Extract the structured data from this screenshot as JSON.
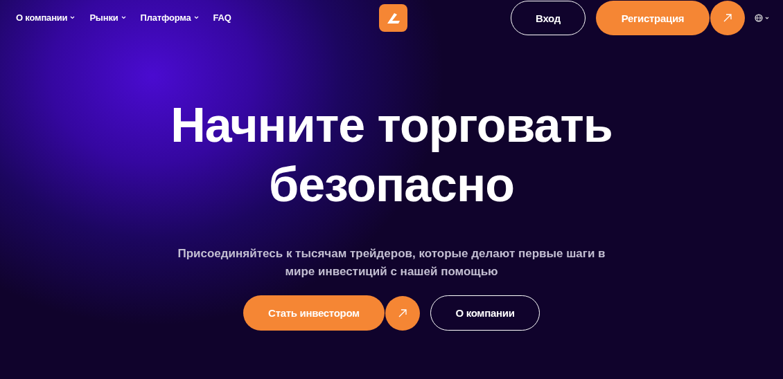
{
  "nav": {
    "items": [
      {
        "label": "О компании",
        "kind": "dropdown"
      },
      {
        "label": "Рынки",
        "kind": "dropdown"
      },
      {
        "label": "Платформа",
        "kind": "dropdown"
      },
      {
        "label": "FAQ",
        "kind": "link"
      }
    ],
    "login": "Вход",
    "register": "Регистрация"
  },
  "hero": {
    "title_lines": [
      "Начните торговать",
      "безопасно"
    ],
    "subtitle": "Присоединяйтесь к тысячам трейдеров, которые делают первые шаги в мире инвестиций с нашей помощью",
    "primary_button": "Стать инвестором",
    "secondary_button": "О компании"
  }
}
